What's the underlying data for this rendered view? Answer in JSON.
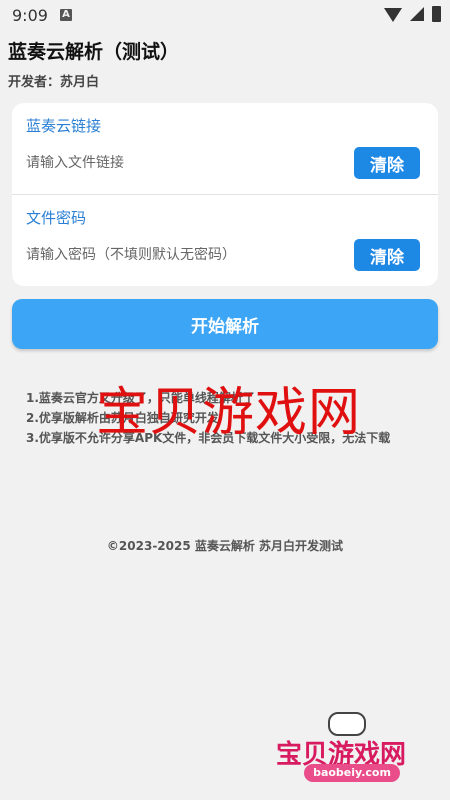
{
  "status_bar": {
    "time": "9:09",
    "notification_icon": "A"
  },
  "header": {
    "title": "蓝奏云解析（测试）",
    "developer": "开发者：苏月白"
  },
  "form": {
    "link": {
      "label": "蓝奏云链接",
      "placeholder": "请输入文件链接",
      "value": "",
      "clear_label": "清除"
    },
    "password": {
      "label": "文件密码",
      "placeholder": "请输入密码（不填则默认无密码）",
      "value": "",
      "clear_label": "清除"
    }
  },
  "actions": {
    "parse_label": "开始解析"
  },
  "notes": [
    "1.蓝奏云官方又升级了，只能单线程解析了",
    "2.优享版解析由苏月白独自研究开发",
    "3.优享版不允许分享APK文件，非会员下载文件大小受限，无法下载"
  ],
  "watermark": "宝贝游戏网",
  "footer": {
    "copyright": "©2023-2025 蓝奏云解析 苏月白开发测试"
  },
  "corner_logo": {
    "text": "宝贝游戏网",
    "url": "baobeiy.com"
  },
  "colors": {
    "accent": "#1e88e5",
    "button": "#3da5f5",
    "label": "#2a7fd4",
    "watermark": "#e01010"
  }
}
